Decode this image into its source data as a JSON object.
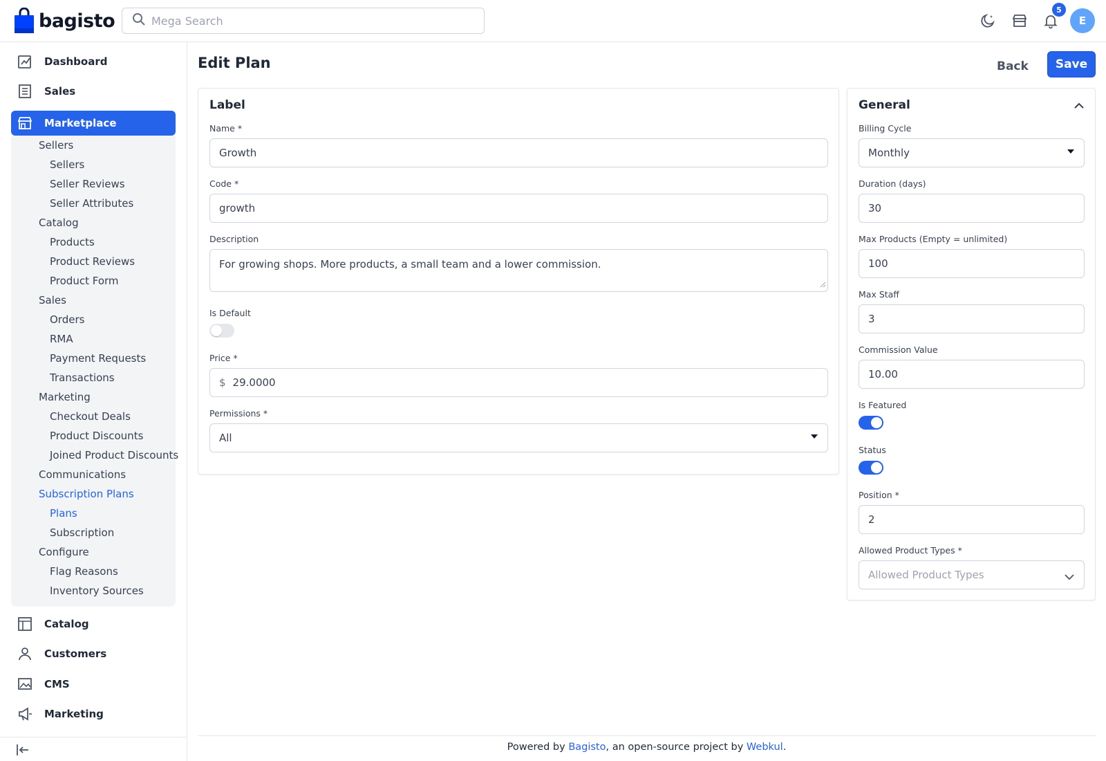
{
  "header": {
    "brand": "bagisto",
    "search_placeholder": "Mega Search",
    "notification_count": "5",
    "avatar_initial": "E"
  },
  "sidebar": {
    "top_items": [
      {
        "label": "Dashboard",
        "icon": "dashboard-icon"
      },
      {
        "label": "Sales",
        "icon": "receipt-icon"
      },
      {
        "label": "Marketplace",
        "icon": "store-icon"
      }
    ],
    "marketplace_sub": {
      "sellers": "Sellers",
      "sellers_list": "Sellers",
      "seller_reviews": "Seller Reviews",
      "seller_attributes": "Seller Attributes",
      "catalog": "Catalog",
      "products": "Products",
      "product_reviews": "Product Reviews",
      "product_form": "Product Form",
      "sales": "Sales",
      "orders": "Orders",
      "rma": "RMA",
      "payment_requests": "Payment Requests",
      "transactions": "Transactions",
      "marketing": "Marketing",
      "checkout_deals": "Checkout Deals",
      "product_discounts": "Product Discounts",
      "joined_product_discounts": "Joined Product Discounts",
      "communications": "Communications",
      "subscription_plans": "Subscription Plans",
      "plans": "Plans",
      "subscription": "Subscription",
      "configure": "Configure",
      "flag_reasons": "Flag Reasons",
      "inventory_sources": "Inventory Sources"
    },
    "bottom_items": [
      {
        "label": "Catalog",
        "icon": "catalog-icon"
      },
      {
        "label": "Customers",
        "icon": "user-icon"
      },
      {
        "label": "CMS",
        "icon": "image-icon"
      },
      {
        "label": "Marketing",
        "icon": "megaphone-icon"
      }
    ]
  },
  "page": {
    "title": "Edit Plan",
    "back_label": "Back",
    "save_label": "Save"
  },
  "label_card": {
    "title": "Label",
    "name_label": "Name *",
    "name_value": "Growth",
    "code_label": "Code *",
    "code_value": "growth",
    "description_label": "Description",
    "description_value": "For growing shops. More products, a small team and a lower commission.",
    "is_default_label": "Is Default",
    "is_default": false,
    "price_label": "Price *",
    "currency_symbol": "$",
    "price_value": "29.0000",
    "permissions_label": "Permissions *",
    "permissions_value": "All"
  },
  "general_card": {
    "title": "General",
    "billing_cycle_label": "Billing Cycle",
    "billing_cycle_value": "Monthly",
    "duration_label": "Duration (days)",
    "duration_value": "30",
    "max_products_label": "Max Products (Empty = unlimited)",
    "max_products_value": "100",
    "max_staff_label": "Max Staff",
    "max_staff_value": "3",
    "commission_label": "Commission Value",
    "commission_value": "10.00",
    "is_featured_label": "Is Featured",
    "is_featured": true,
    "status_label": "Status",
    "status": true,
    "position_label": "Position *",
    "position_value": "2",
    "allowed_types_label": "Allowed Product Types *",
    "allowed_types_placeholder": "Allowed Product Types"
  },
  "footer": {
    "prefix": "Powered by ",
    "bagisto_link": "Bagisto",
    "middle": ", an open-source project by ",
    "webkul_link": "Webkul",
    "suffix": "."
  },
  "colors": {
    "accent": "#2563eb",
    "brand_bag": "#0041ff"
  }
}
